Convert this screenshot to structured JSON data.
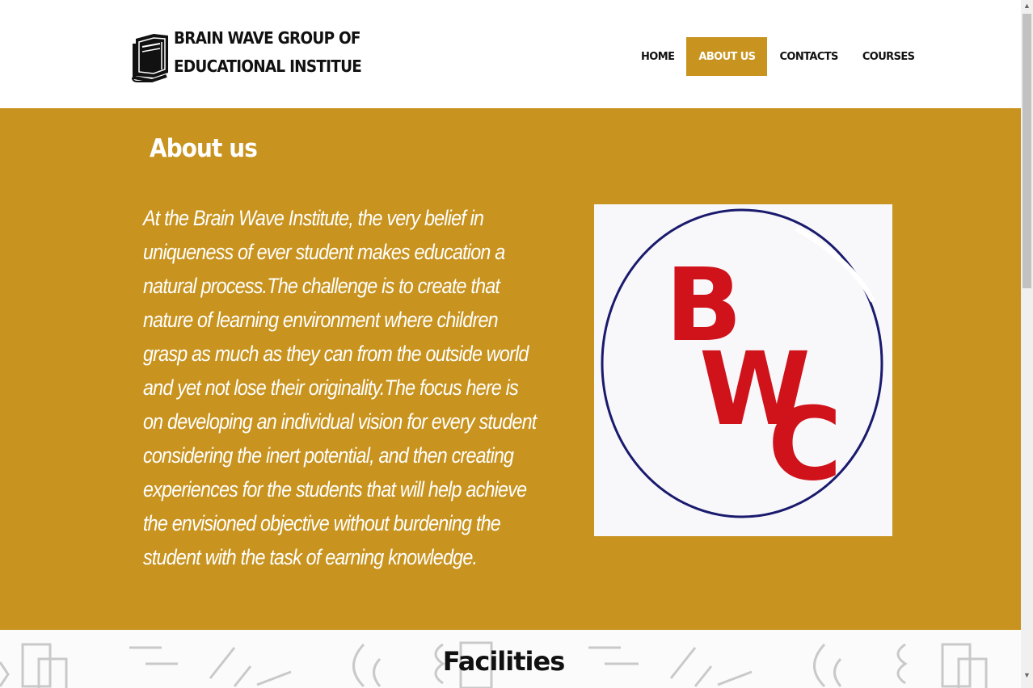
{
  "header": {
    "brand": "BRAIN WAVE GROUP OF EDUCATIONAL INSTITUE",
    "logo_icon": "book-icon"
  },
  "nav": {
    "items": [
      {
        "label": "HOME",
        "active": false
      },
      {
        "label": "ABOUT US",
        "active": true
      },
      {
        "label": "CONTACTS",
        "active": false
      },
      {
        "label": "COURSES",
        "active": false
      }
    ]
  },
  "about": {
    "title": "About us",
    "body": "At the Brain Wave Institute, the very belief in uniqueness of ever student makes education a natural process.The challenge is to create that nature of learning environment where children grasp as much as they can from the outside world and yet not lose their originality.The focus here is on developing an individual vision for every student considering the inert potential, and then creating experiences for the students that will help achieve the envisioned objective without burdening the student with the task of earning knowledge.",
    "image": {
      "letters": [
        "B",
        "W",
        "C"
      ],
      "letter_color": "#d0121b",
      "ring_color": "#1a1a6e"
    }
  },
  "facilities": {
    "title": "Facilities"
  },
  "colors": {
    "accent": "#c8931e",
    "text_dark": "#111111",
    "white": "#ffffff"
  }
}
